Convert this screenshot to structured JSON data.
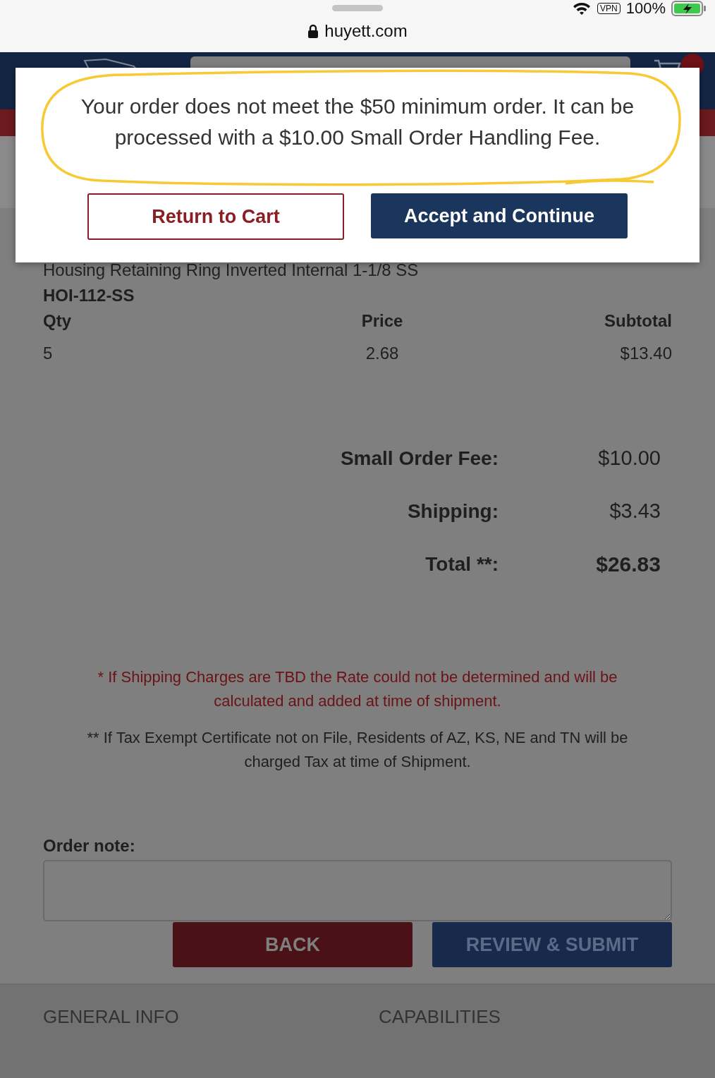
{
  "browser": {
    "battery": "100%",
    "vpn": "VPN",
    "address": "huyett.com"
  },
  "product": {
    "name": "Housing Retaining Ring Inverted Internal 1-1/8 SS",
    "code": "HOI-112-SS",
    "columns": [
      "Qty",
      "Price",
      "Subtotal"
    ],
    "values": [
      "5",
      "2.68",
      "$13.40"
    ]
  },
  "totals": [
    {
      "label": "Small Order Fee:",
      "value": "$10.00",
      "kind": "normal"
    },
    {
      "label": "Shipping:",
      "value": "$3.43",
      "kind": "normal"
    },
    {
      "label": "Total **:",
      "value": "$26.83",
      "kind": "total"
    }
  ],
  "notes": [
    {
      "text": "* If Shipping Charges are TBD the Rate could not be determined and will be calculated and added at time of shipment.",
      "kind": "warning"
    },
    {
      "text": "** If Tax Exempt Certificate not on File, Residents of AZ, KS, NE and TN will be charged Tax at time of Shipment.",
      "kind": "info"
    }
  ],
  "order_note": {
    "label": "Order note:"
  },
  "actions": [
    {
      "label": "BACK",
      "kind": "back"
    },
    {
      "label": "REVIEW & SUBMIT",
      "kind": "submit"
    }
  ],
  "footer": [
    {
      "heading": "GENERAL INFO"
    },
    {
      "heading": "CAPABILITIES"
    }
  ],
  "dialog": {
    "message": "Your order does not meet the $50 minimum order. It can be processed with a $10.00 Small Order Handling Fee.",
    "buttons": [
      {
        "label": "Return to Cart",
        "kind": "secondary"
      },
      {
        "label": "Accept and Continue",
        "kind": "primary"
      }
    ]
  }
}
